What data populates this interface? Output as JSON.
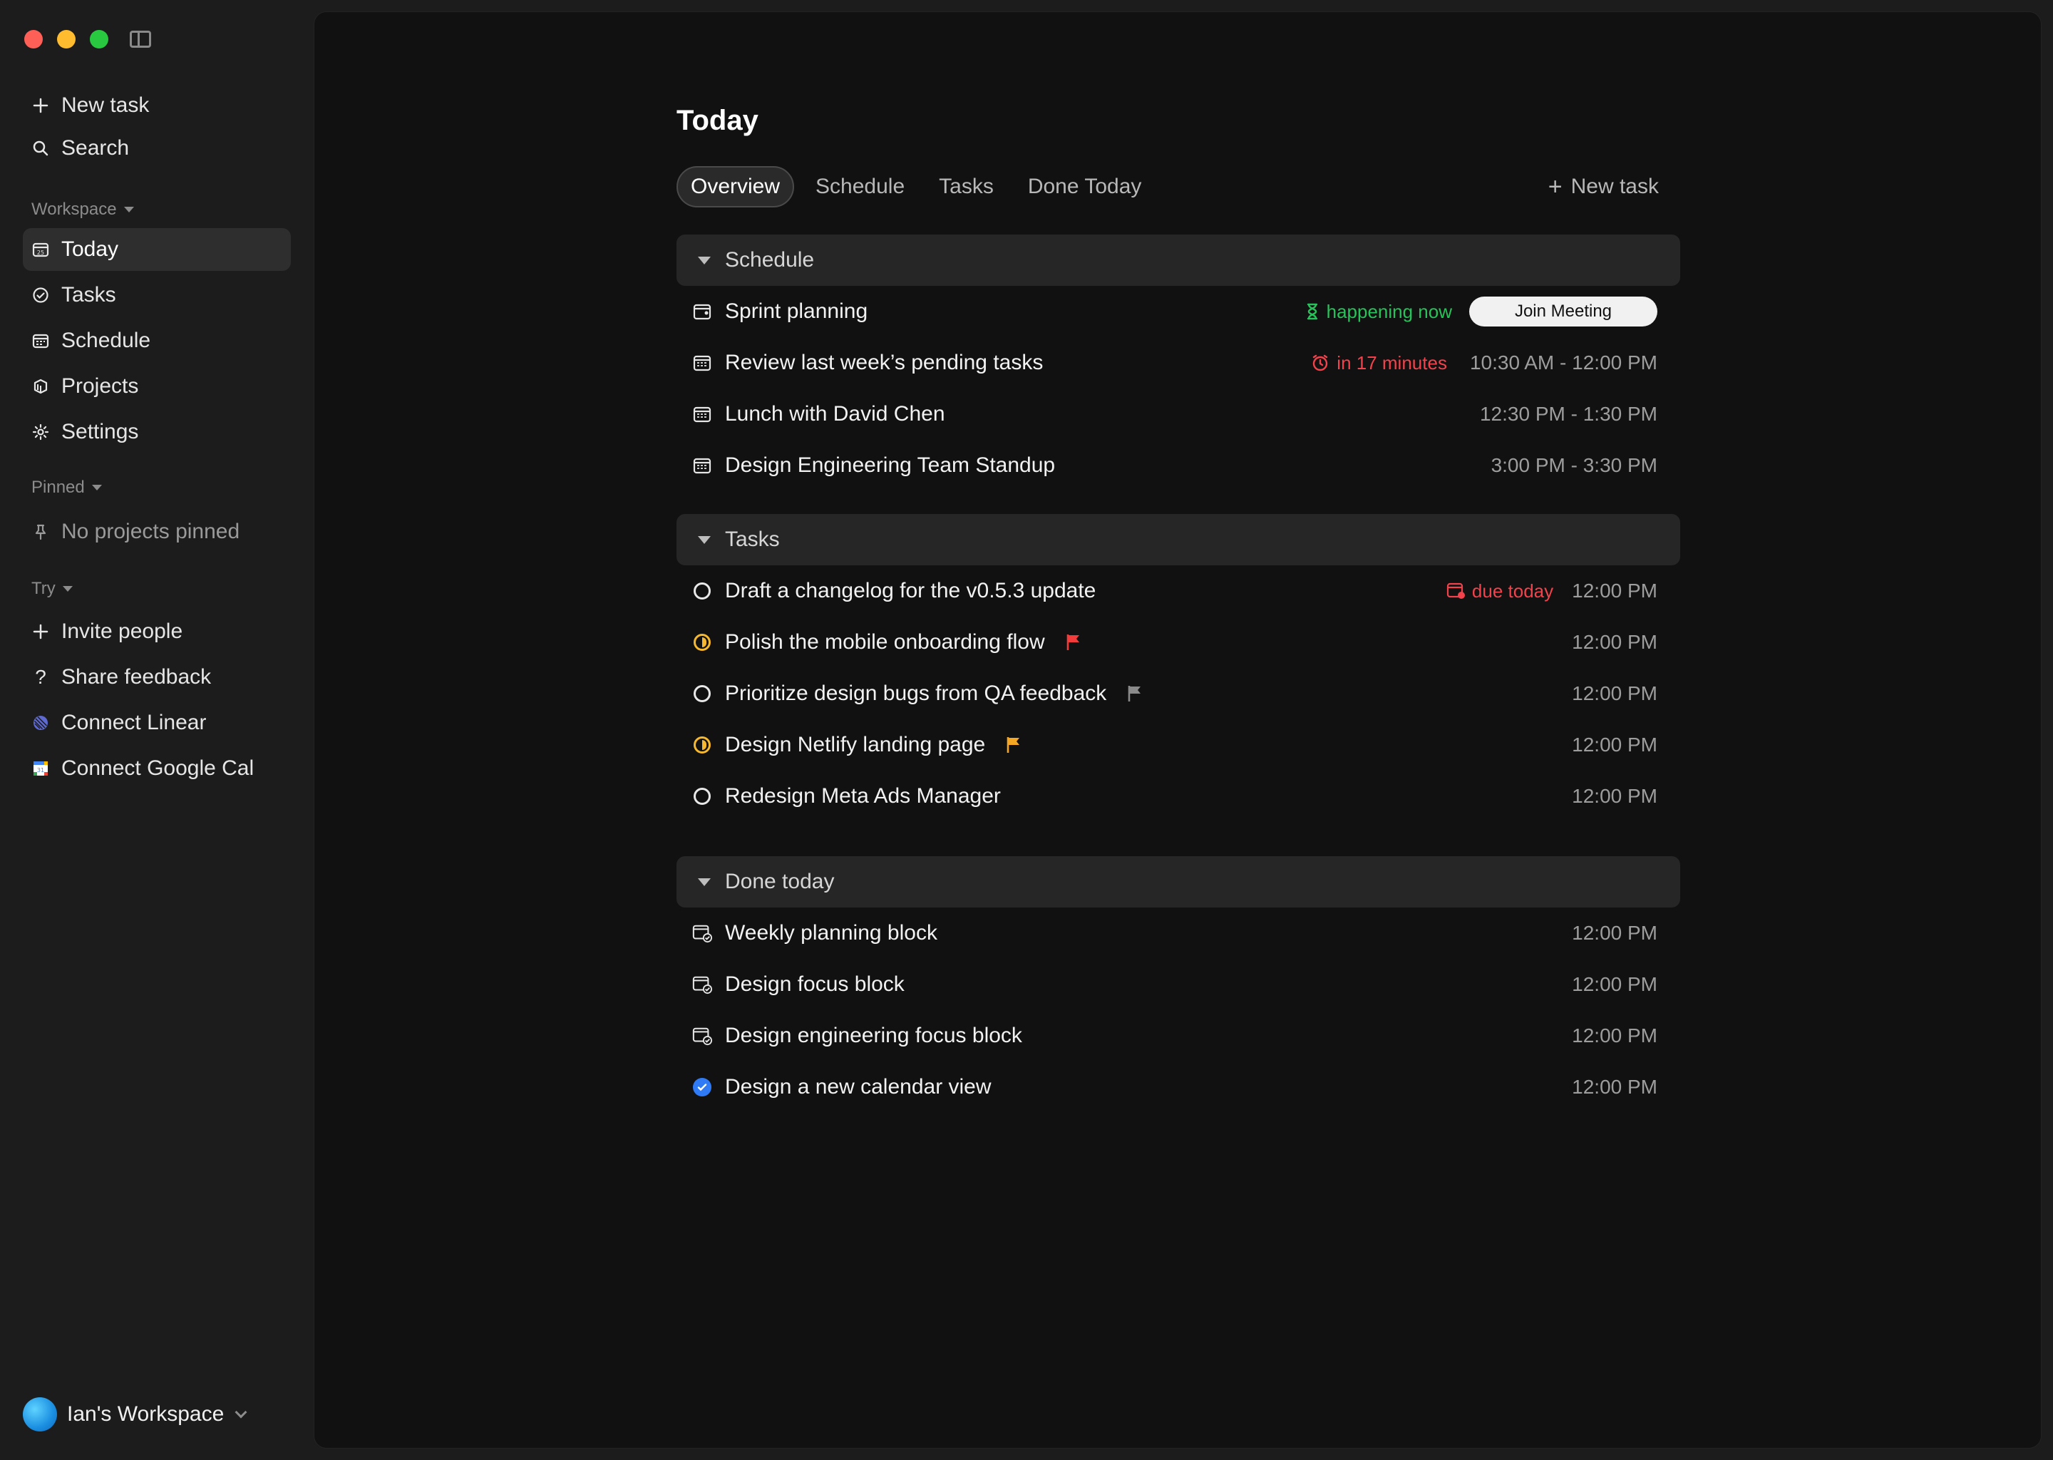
{
  "sidebar": {
    "new_task": "New task",
    "search": "Search",
    "workspace_header": "Workspace",
    "nav": [
      {
        "label": "Today"
      },
      {
        "label": "Tasks"
      },
      {
        "label": "Schedule"
      },
      {
        "label": "Projects"
      },
      {
        "label": "Settings"
      }
    ],
    "pinned_header": "Pinned",
    "pinned_empty": "No projects pinned",
    "try_header": "Try",
    "try_items": [
      {
        "label": "Invite people"
      },
      {
        "label": "Share feedback"
      },
      {
        "label": "Connect Linear"
      },
      {
        "label": "Connect Google Cal"
      }
    ],
    "workspace_name": "Ian's Workspace"
  },
  "main": {
    "title": "Today",
    "tabs": [
      {
        "label": "Overview",
        "active": true
      },
      {
        "label": "Schedule"
      },
      {
        "label": "Tasks"
      },
      {
        "label": "Done Today"
      }
    ],
    "new_task": "New task",
    "sections": {
      "schedule": {
        "title": "Schedule",
        "items": [
          {
            "title": "Sprint planning",
            "status": "happening now",
            "action": "Join Meeting"
          },
          {
            "title": "Review last week’s pending tasks",
            "status": "in 17 minutes",
            "time": "10:30 AM - 12:00 PM"
          },
          {
            "title": "Lunch with David Chen",
            "time": "12:30 PM - 1:30 PM"
          },
          {
            "title": "Design Engineering Team Standup",
            "time": "3:00 PM - 3:30 PM"
          }
        ]
      },
      "tasks": {
        "title": "Tasks",
        "items": [
          {
            "title": "Draft a changelog for the v0.5.3 update",
            "badge": "due today",
            "time": "12:00 PM",
            "state": "todo"
          },
          {
            "title": "Polish the mobile onboarding flow",
            "time": "12:00 PM",
            "state": "in-progress",
            "flag": "#f23c3c"
          },
          {
            "title": "Prioritize design bugs from QA feedback",
            "time": "12:00 PM",
            "state": "todo",
            "flag": "#8a8a8a"
          },
          {
            "title": "Design Netlify landing page",
            "time": "12:00 PM",
            "state": "in-progress",
            "flag": "#f5a623"
          },
          {
            "title": "Redesign Meta Ads Manager",
            "time": "12:00 PM",
            "state": "todo"
          }
        ]
      },
      "done": {
        "title": "Done today",
        "items": [
          {
            "title": "Weekly planning block",
            "time": "12:00 PM"
          },
          {
            "title": "Design focus block",
            "time": "12:00 PM"
          },
          {
            "title": "Design engineering focus block",
            "time": "12:00 PM"
          },
          {
            "title": "Design a new calendar view",
            "time": "12:00 PM"
          }
        ]
      }
    }
  },
  "colors": {
    "accent_green": "#29c25a",
    "accent_red": "#f2424b",
    "accent_blue": "#2f7bf6",
    "accent_yellow": "#f5b82e"
  }
}
